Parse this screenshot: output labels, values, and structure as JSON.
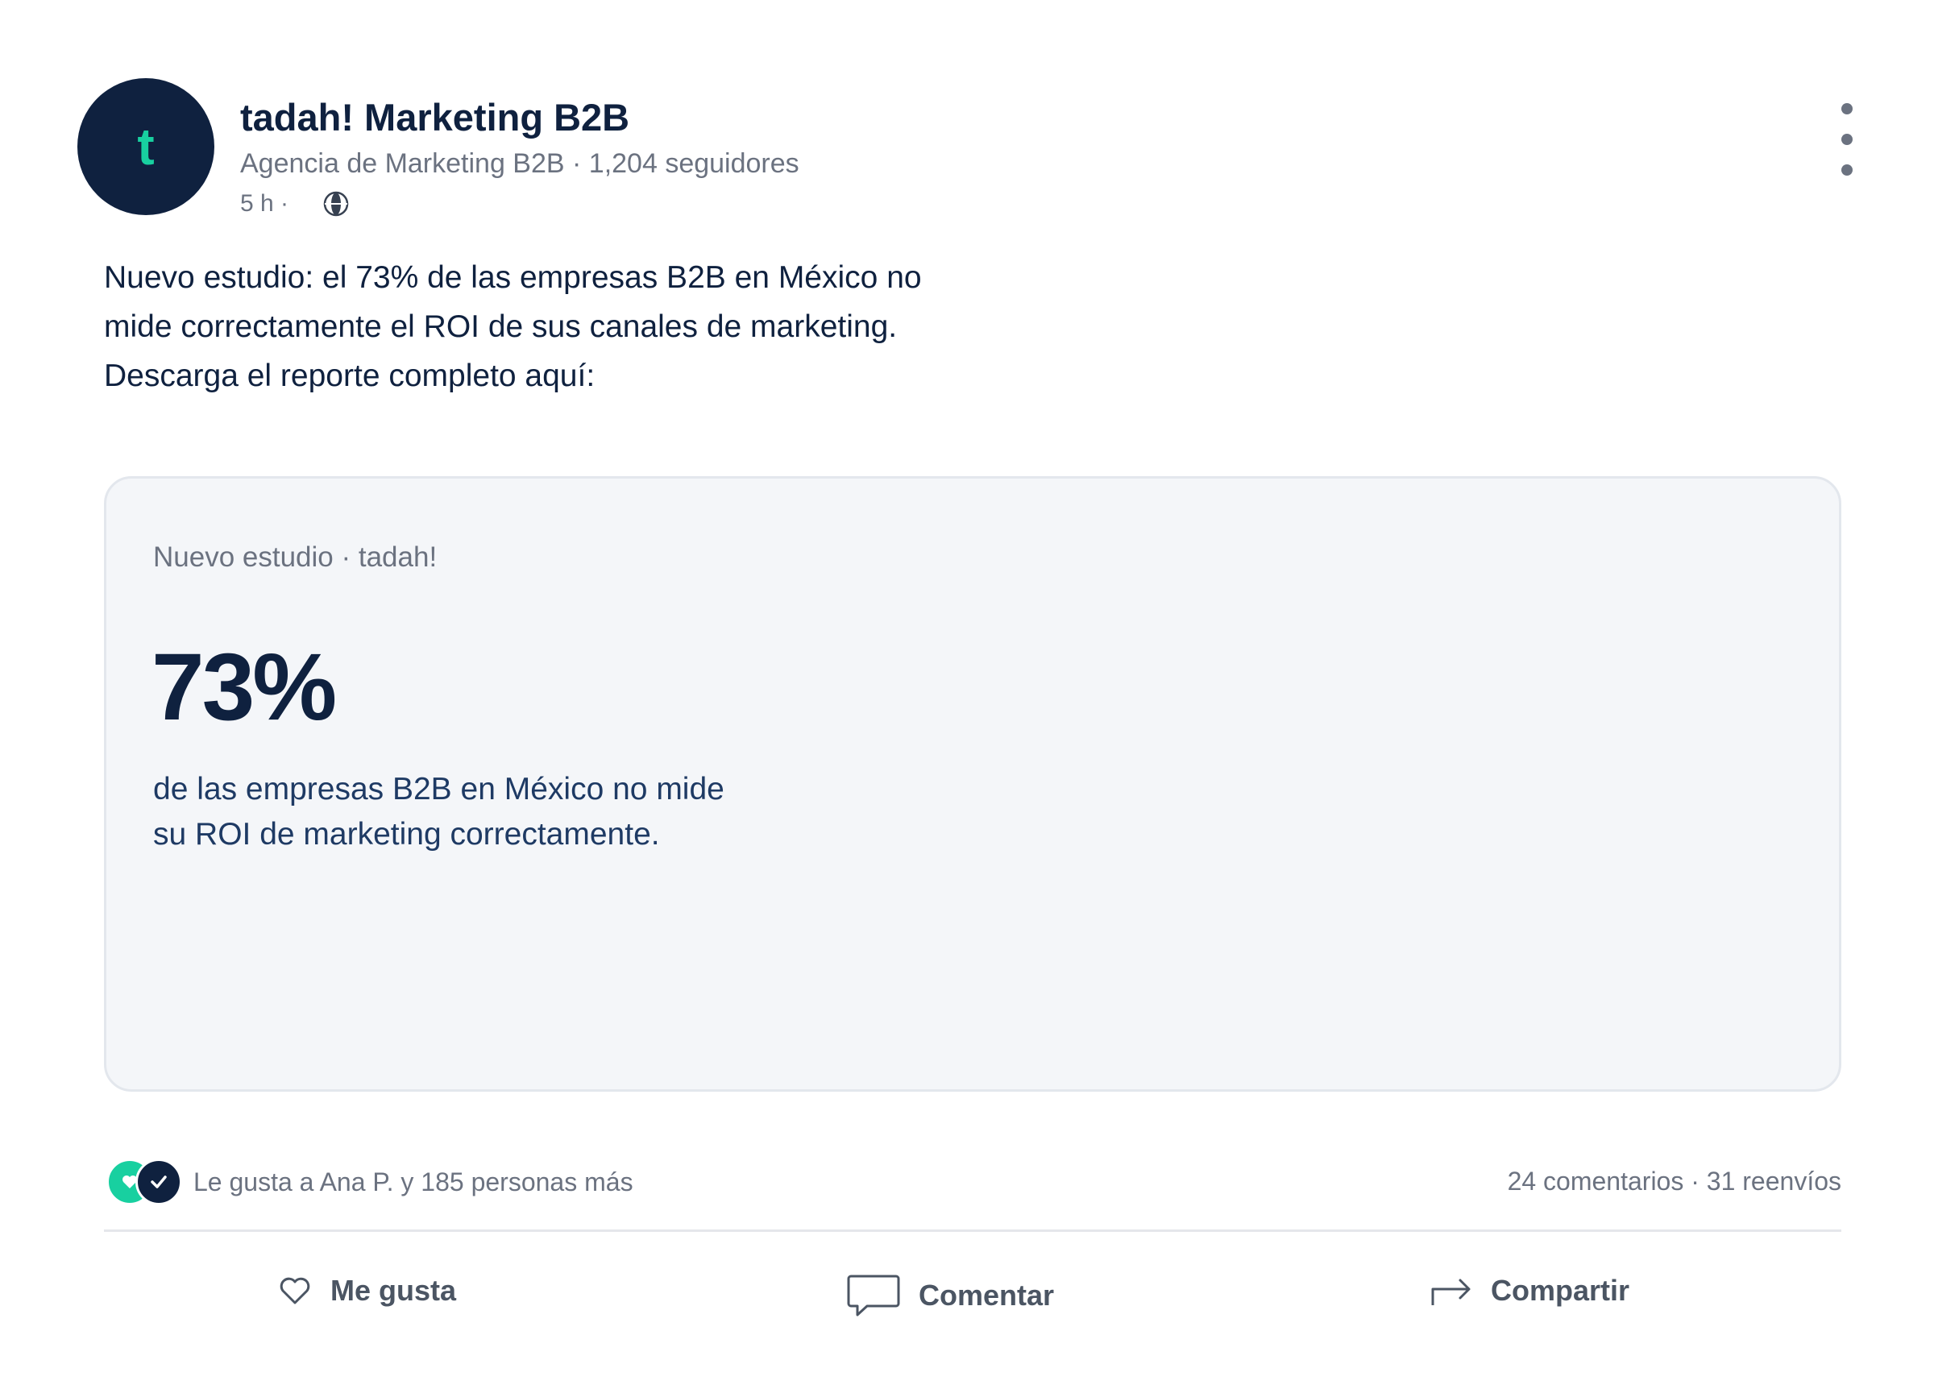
{
  "author": {
    "avatar_letter": "t",
    "name": "tadah! Marketing B2B",
    "subtitle": "Agencia de Marketing B2B · 1,204 seguidores",
    "time": "5 h ·"
  },
  "post": {
    "lines": [
      "Nuevo estudio: el 73% de las empresas B2B en México no",
      "mide correctamente el ROI de sus canales de marketing.",
      "Descarga el reporte completo aquí:"
    ]
  },
  "card": {
    "kicker": "Nuevo estudio · tadah!",
    "stat": "73%",
    "desc_lines": [
      "de las empresas B2B en México no mide",
      "su ROI de marketing correctamente."
    ]
  },
  "social": {
    "reactions_text": "Le gusta a Ana P. y 185 personas más",
    "counts_text": "24 comentarios · 31 reenvíos"
  },
  "actions": {
    "like": "Me gusta",
    "comment": "Comentar",
    "share": "Compartir"
  },
  "colors": {
    "brand_navy": "#0f213f",
    "brand_green": "#18d0a0",
    "muted": "#6b7280",
    "card_bg": "#f4f6f9"
  },
  "icons": {
    "privacy": "globe-icon",
    "menu": "more-vertical-icon",
    "like": "heart-icon",
    "comment": "comment-icon",
    "share": "share-arrow-icon"
  }
}
